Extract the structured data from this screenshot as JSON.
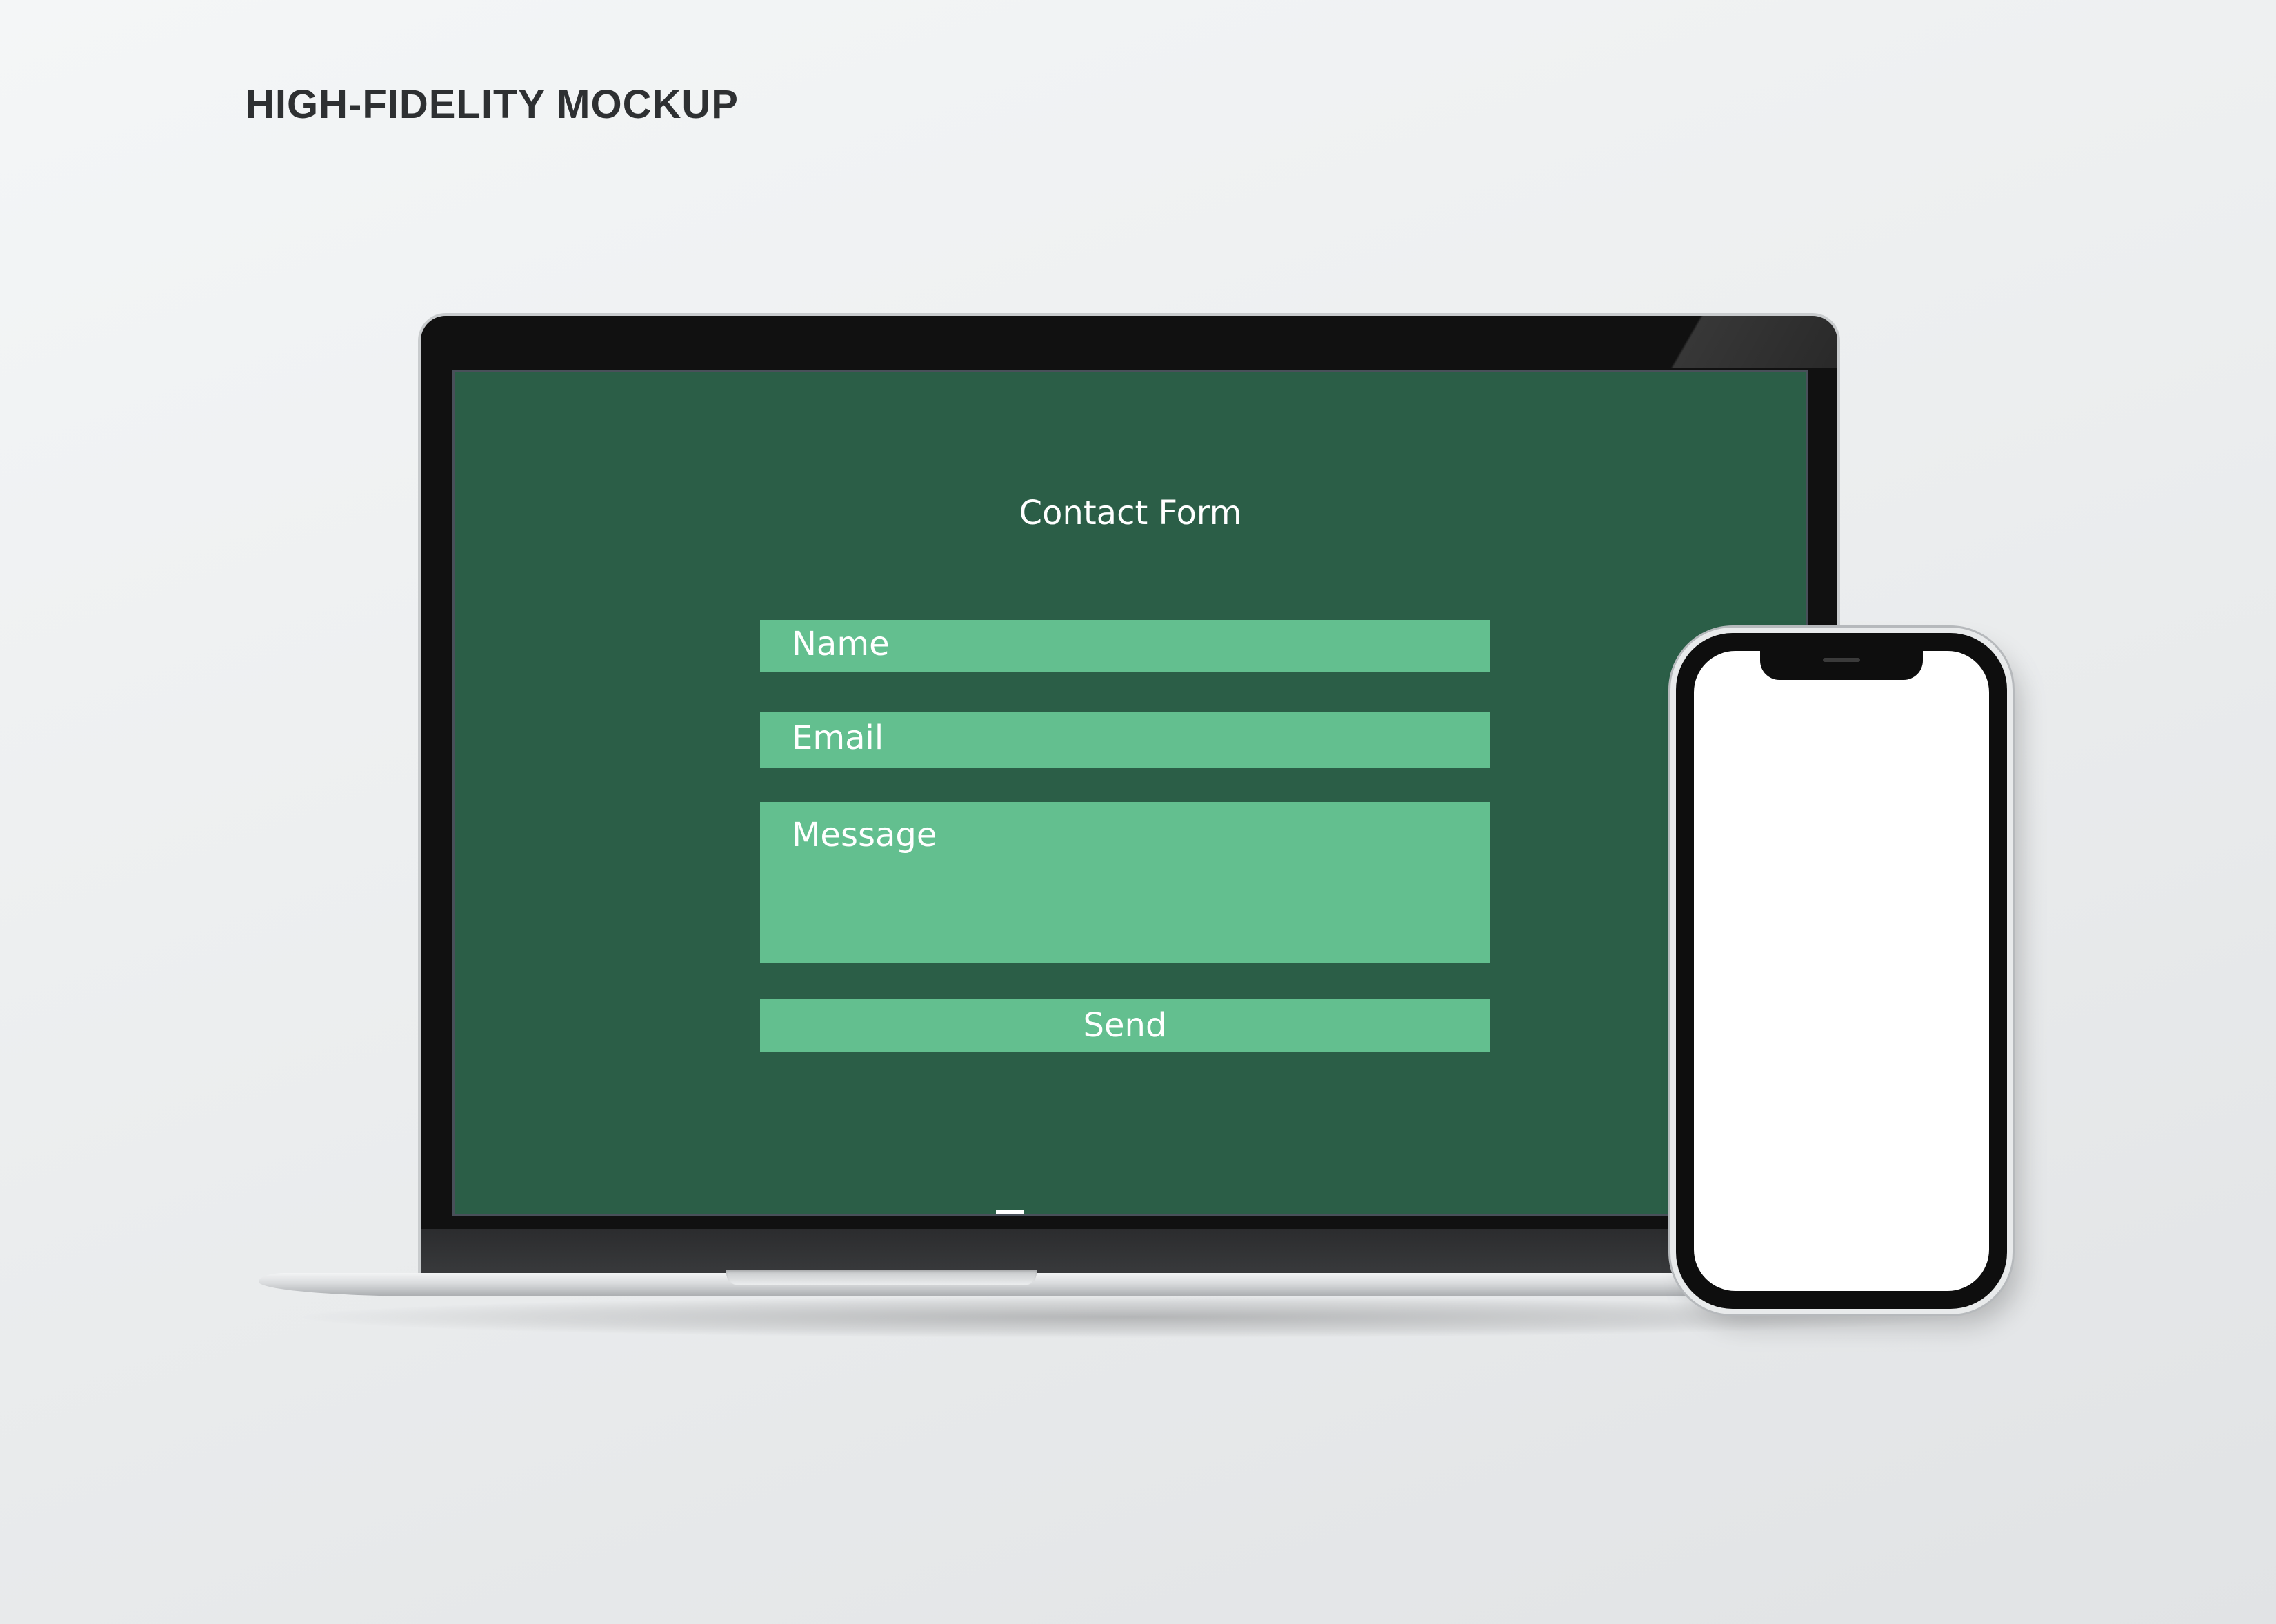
{
  "heading": "HIGH-FIDELITY MOCKUP",
  "contact_form": {
    "title": "Contact Form",
    "name_placeholder": "Name",
    "email_placeholder": "Email",
    "message_placeholder": "Message",
    "send_label": "Send"
  },
  "colors": {
    "background": "#eceeef",
    "screen_bg": "#2b5e47",
    "field_bg": "#63bf8f",
    "text": "#ffffff",
    "heading_text": "#2e3032"
  }
}
